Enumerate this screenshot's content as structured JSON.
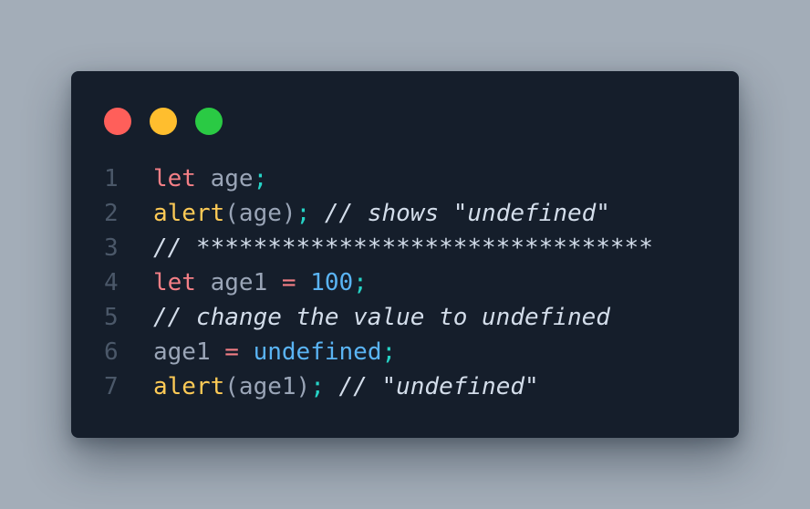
{
  "window": {
    "controls": [
      "close",
      "minimize",
      "maximize"
    ],
    "colors": {
      "background": "#151e2b",
      "close": "#ff5f5a",
      "minimize": "#ffbe2e",
      "maximize": "#2aca44"
    }
  },
  "code": {
    "language": "javascript",
    "lines": [
      {
        "number": "1",
        "tokens": [
          {
            "type": "kw",
            "text": "let"
          },
          {
            "type": "id",
            "text": " age"
          },
          {
            "type": "pn",
            "text": ";"
          }
        ]
      },
      {
        "number": "2",
        "tokens": [
          {
            "type": "fn",
            "text": "alert"
          },
          {
            "type": "id",
            "text": "(age)"
          },
          {
            "type": "pn",
            "text": ";"
          },
          {
            "type": "cm",
            "text": " // shows \"undefined\""
          }
        ]
      },
      {
        "number": "3",
        "tokens": [
          {
            "type": "cm",
            "text": "// ********************************"
          }
        ]
      },
      {
        "number": "4",
        "tokens": [
          {
            "type": "kw",
            "text": "let"
          },
          {
            "type": "id",
            "text": " age1 "
          },
          {
            "type": "op",
            "text": "="
          },
          {
            "type": "id",
            "text": " "
          },
          {
            "type": "num",
            "text": "100"
          },
          {
            "type": "pn",
            "text": ";"
          }
        ]
      },
      {
        "number": "5",
        "tokens": [
          {
            "type": "cm",
            "text": "// change the value to undefined"
          }
        ]
      },
      {
        "number": "6",
        "tokens": [
          {
            "type": "id",
            "text": "age1 "
          },
          {
            "type": "op",
            "text": "="
          },
          {
            "type": "id",
            "text": " "
          },
          {
            "type": "num",
            "text": "undefined"
          },
          {
            "type": "pn",
            "text": ";"
          }
        ]
      },
      {
        "number": "7",
        "tokens": [
          {
            "type": "fn",
            "text": "alert"
          },
          {
            "type": "id",
            "text": "(age1)"
          },
          {
            "type": "pn",
            "text": ";"
          },
          {
            "type": "cm",
            "text": " // \"undefined\""
          }
        ]
      }
    ]
  }
}
